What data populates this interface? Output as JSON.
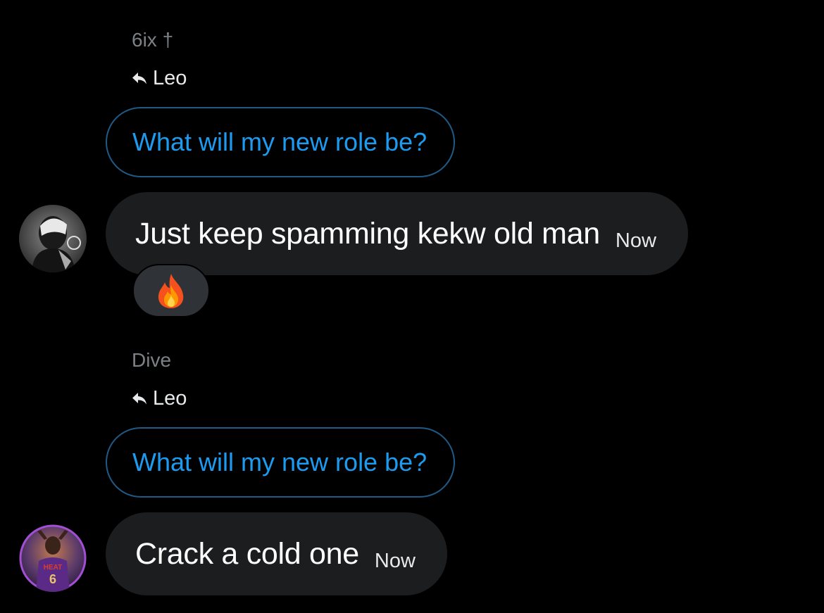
{
  "messages": [
    {
      "sender": "6ix †",
      "reply_to_label": "Leo",
      "quoted_text": "What will my new role be?",
      "text": "Just keep spamming kekw old man",
      "time": "Now",
      "avatar": "user-avatar-masked-figure",
      "reaction": "fire-emoji"
    },
    {
      "sender": "Dive",
      "reply_to_label": "Leo",
      "quoted_text": "What will my new role be?",
      "text": "Crack a cold one",
      "time": "Now",
      "avatar": "user-avatar-basketball-player"
    }
  ],
  "colors": {
    "background": "#000000",
    "bubble": "#1c1d1f",
    "quote_border": "#1f5a87",
    "quote_text": "#1d9bf0",
    "sender_text": "#7d8185",
    "reaction_bg": "#2f3236"
  }
}
